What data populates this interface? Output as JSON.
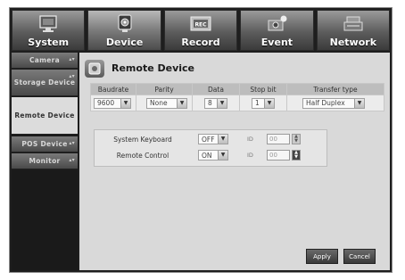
{
  "tabs": [
    {
      "label": "System",
      "icon": "monitor-icon"
    },
    {
      "label": "Device",
      "icon": "camera-icon",
      "active": true
    },
    {
      "label": "Record",
      "icon": "record-rec-icon",
      "rec_text": "REC"
    },
    {
      "label": "Event",
      "icon": "event-camera-icon"
    },
    {
      "label": "Network",
      "icon": "network-icon"
    }
  ],
  "menu": [
    {
      "label": "Camera"
    },
    {
      "label": "Storage Device"
    },
    {
      "label": "Remote Device",
      "active": true
    },
    {
      "label": "POS Device"
    },
    {
      "label": "Monitor"
    }
  ],
  "panel": {
    "title": "Remote Device",
    "table": {
      "headers": [
        "Baudrate",
        "Parity",
        "Data",
        "Stop bit",
        "Transfer type"
      ],
      "values": [
        "9600",
        "None",
        "8",
        "1",
        "Half Duplex"
      ]
    },
    "rows": [
      {
        "label": "System Keyboard",
        "value": "OFF",
        "id_label": "ID",
        "id_value": "00"
      },
      {
        "label": "Remote Control",
        "value": "ON",
        "id_label": "ID",
        "id_value": "00"
      }
    ],
    "buttons": {
      "apply": "Apply",
      "cancel": "Cancel"
    }
  },
  "colors": {
    "active_menu": "#dcdcdc",
    "panel_bg": "#d9d9d9",
    "frame": "#1e1e1e"
  }
}
